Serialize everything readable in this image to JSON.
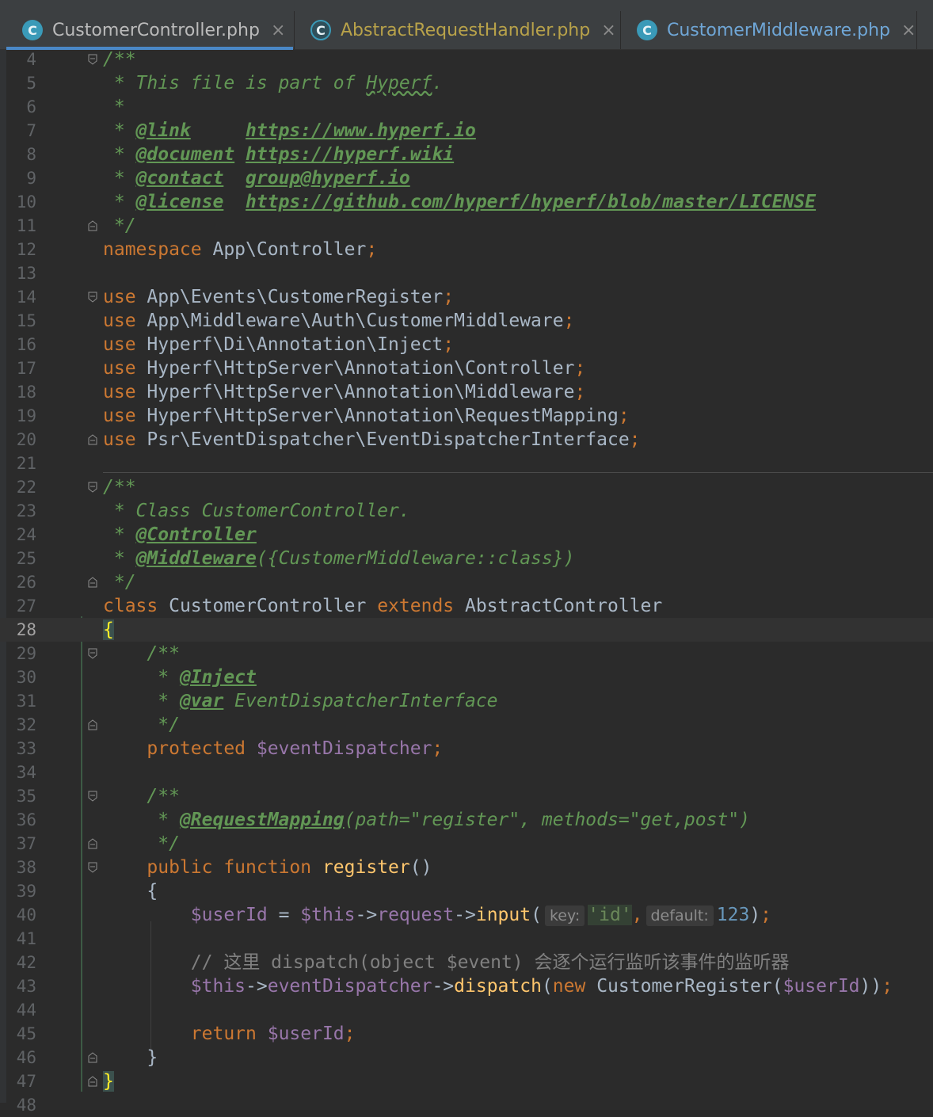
{
  "tabs": [
    {
      "label": "CustomerController.php",
      "icon": "C",
      "active": true
    },
    {
      "label": "AbstractRequestHandler.php",
      "icon": "C",
      "active": false
    },
    {
      "label": "CustomerMiddleware.php",
      "icon": "C",
      "active": false
    }
  ],
  "close_glyph": "×",
  "current_line": 28,
  "lines": [
    {
      "n": "4"
    },
    {
      "n": "5"
    },
    {
      "n": "6"
    },
    {
      "n": "7"
    },
    {
      "n": "8"
    },
    {
      "n": "9"
    },
    {
      "n": "10"
    },
    {
      "n": "11"
    },
    {
      "n": "12"
    },
    {
      "n": "13"
    },
    {
      "n": "14"
    },
    {
      "n": "15"
    },
    {
      "n": "16"
    },
    {
      "n": "17"
    },
    {
      "n": "18"
    },
    {
      "n": "19"
    },
    {
      "n": "20"
    },
    {
      "n": "21"
    },
    {
      "n": "22"
    },
    {
      "n": "23"
    },
    {
      "n": "24"
    },
    {
      "n": "25"
    },
    {
      "n": "26"
    },
    {
      "n": "27"
    },
    {
      "n": "28"
    },
    {
      "n": "29"
    },
    {
      "n": "30"
    },
    {
      "n": "31"
    },
    {
      "n": "32"
    },
    {
      "n": "33"
    },
    {
      "n": "34"
    },
    {
      "n": "35"
    },
    {
      "n": "36"
    },
    {
      "n": "37"
    },
    {
      "n": "38"
    },
    {
      "n": "39"
    },
    {
      "n": "40"
    },
    {
      "n": "41"
    },
    {
      "n": "42"
    },
    {
      "n": "43"
    },
    {
      "n": "44"
    },
    {
      "n": "45"
    },
    {
      "n": "46"
    },
    {
      "n": "47"
    },
    {
      "n": "48"
    }
  ],
  "code": {
    "l4": "/**",
    "l5_a": " * This file is part of ",
    "l5_b": "Hyperf",
    "l5_c": ".",
    "l6": " *",
    "l7_star": " * ",
    "l7_tag": "@link",
    "l7_gap": "     ",
    "l7_val": "https://www.hyperf.io",
    "l8_star": " * ",
    "l8_tag": "@document",
    "l8_gap": " ",
    "l8_val": "https://hyperf.wiki",
    "l9_star": " * ",
    "l9_tag": "@contact",
    "l9_gap": "  ",
    "l9_val": "group@hyperf.io",
    "l10_star": " * ",
    "l10_tag": "@license",
    "l10_gap": "  ",
    "l10_val": "https://github.com/hyperf/hyperf/blob/master/LICENSE",
    "l11": " */",
    "l12_kw": "namespace",
    "l12_ns": " App\\Controller",
    "l12_semi": ";",
    "use_kw": "use",
    "l14": " App\\Events\\CustomerRegister",
    "l15": " App\\Middleware\\Auth\\CustomerMiddleware",
    "l16": " Hyperf\\Di\\Annotation\\Inject",
    "l17": " Hyperf\\HttpServer\\Annotation\\Controller",
    "l18": " Hyperf\\HttpServer\\Annotation\\Middleware",
    "l19": " Hyperf\\HttpServer\\Annotation\\RequestMapping",
    "l20": " Psr\\EventDispatcher\\EventDispatcherInterface",
    "semi": ";",
    "l22": "/**",
    "l23": " * Class CustomerController.",
    "l24_star": " * ",
    "l24_tag": "@Controller",
    "l25_star": " * ",
    "l25_tag": "@Middleware",
    "l25_rest": "({CustomerMiddleware::class})",
    "l26": " */",
    "l27_class": "class",
    "l27_name": " CustomerController ",
    "l27_extends": "extends",
    "l27_parent": " AbstractController",
    "l28": "{",
    "l29": "    /**",
    "l30_star": "     * ",
    "l30_tag": "@Inject",
    "l31_star": "     * ",
    "l31_tag": "@var",
    "l31_rest": " EventDispatcherInterface",
    "l32": "     */",
    "l33_indent": "    ",
    "l33_kw": "protected",
    "l33_var": " $eventDispatcher",
    "l35": "    /**",
    "l36_star": "     * ",
    "l36_tag": "@RequestMapping",
    "l36_rest": "(path=\"register\", methods=\"get,post\")",
    "l37": "     */",
    "l38_indent": "    ",
    "l38_kw1": "public",
    "l38_kw2": " function",
    "l38_fn": " register",
    "l38_paren": "()",
    "l39": "    {",
    "l40_indent": "        ",
    "l40_var": "$userId",
    "l40_eq": " = ",
    "l40_this": "$this",
    "l40_arrow1": "->",
    "l40_req": "request",
    "l40_arrow2": "->",
    "l40_fn": "input",
    "l40_open": "(",
    "l40_hint1": "key:",
    "l40_str": "'id'",
    "l40_comma": ",",
    "l40_hint2": "default:",
    "l40_num": "123",
    "l40_close": ")",
    "l42": "        // 这里 dispatch(object $event) 会逐个运行监听该事件的监听器",
    "l43_indent": "        ",
    "l43_this": "$this",
    "l43_arrow1": "->",
    "l43_prop": "eventDispatcher",
    "l43_arrow2": "->",
    "l43_fn": "dispatch",
    "l43_open": "(",
    "l43_new": "new",
    "l43_cls": " CustomerRegister(",
    "l43_var": "$userId",
    "l43_close": "))",
    "l45_indent": "        ",
    "l45_kw": "return",
    "l45_var": " $userId",
    "l46": "    }",
    "l47": "}"
  }
}
